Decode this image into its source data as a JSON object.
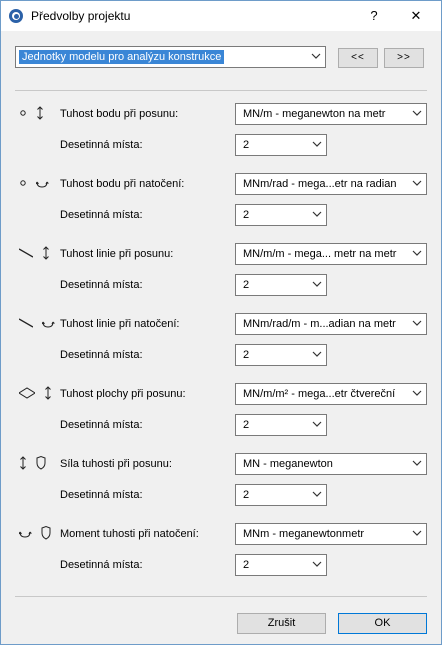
{
  "window": {
    "title": "Předvolby projektu",
    "help": "?",
    "close": "✕"
  },
  "top": {
    "select_value": "Jednotky modelu pro analýzu konstrukce",
    "prev_label": "<<",
    "next_label": ">>"
  },
  "sections": [
    {
      "icons": [
        "point-icon",
        "translation-arrow-icon"
      ],
      "label": "Tuhost bodu při posunu:",
      "unit": "MN/m - meganewton na metr",
      "dec_label": "Desetinná místa:",
      "dec_value": "2"
    },
    {
      "icons": [
        "point-icon",
        "rotation-icon"
      ],
      "label": "Tuhost bodu při natočení:",
      "unit": "MNm/rad - mega...etr na radian",
      "dec_label": "Desetinná místa:",
      "dec_value": "2"
    },
    {
      "icons": [
        "line-icon",
        "translation-arrow-icon"
      ],
      "label": "Tuhost linie při posunu:",
      "unit": "MN/m/m - mega... metr na metr",
      "dec_label": "Desetinná místa:",
      "dec_value": "2"
    },
    {
      "icons": [
        "line-icon",
        "rotation-icon"
      ],
      "label": "Tuhost linie při natočení:",
      "unit": "MNm/rad/m - m...adian na metr",
      "dec_label": "Desetinná místa:",
      "dec_value": "2"
    },
    {
      "icons": [
        "surface-icon",
        "translation-arrow-icon"
      ],
      "label": "Tuhost plochy při posunu:",
      "unit": "MN/m/m² - mega...etr čtvereční",
      "dec_label": "Desetinná místa:",
      "dec_value": "2"
    },
    {
      "icons": [
        "translation-arrow-icon",
        "shield-icon"
      ],
      "label": "Síla tuhosti při posunu:",
      "unit": "MN - meganewton",
      "dec_label": "Desetinná místa:",
      "dec_value": "2"
    },
    {
      "icons": [
        "rotation-icon",
        "shield-icon"
      ],
      "label": "Moment tuhosti při natočení:",
      "unit": "MNm - meganewtonmetr",
      "dec_label": "Desetinná místa:",
      "dec_value": "2"
    }
  ],
  "footer": {
    "cancel_label": "Zrušit",
    "ok_label": "OK"
  }
}
